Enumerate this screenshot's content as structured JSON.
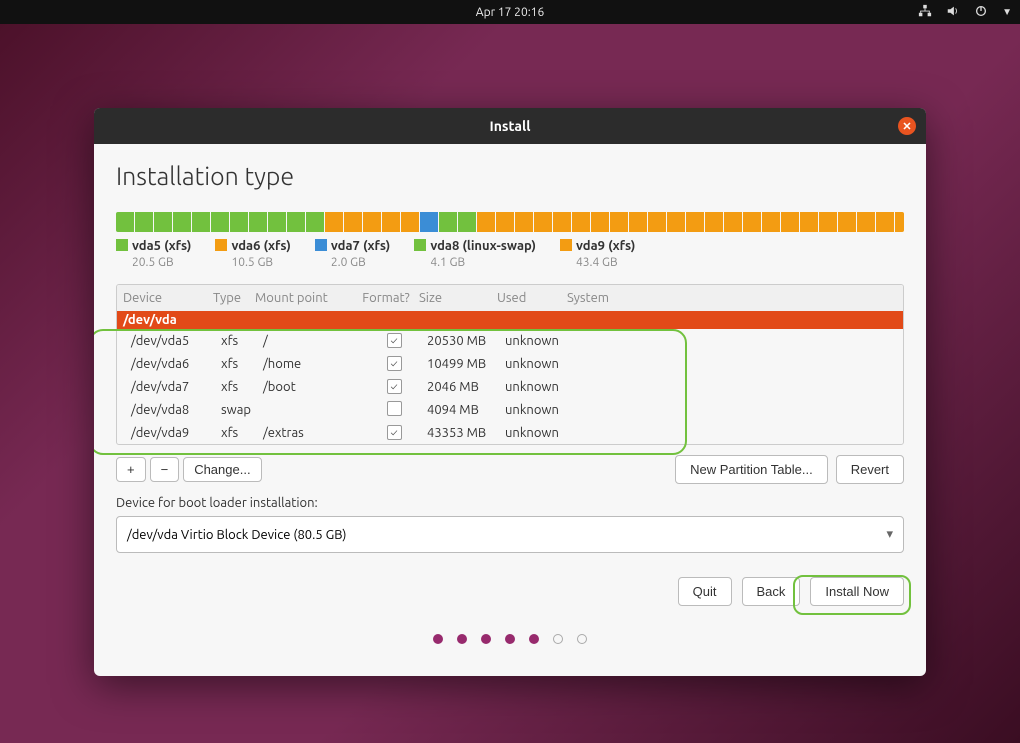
{
  "topbar": {
    "datetime": "Apr 17  20:16"
  },
  "window": {
    "title": "Install",
    "heading": "Installation type"
  },
  "legend": [
    {
      "name": "vda5 (xfs)",
      "sub": "20.5 GB",
      "color": "#72c13e"
    },
    {
      "name": "vda6 (xfs)",
      "sub": "10.5 GB",
      "color": "#f39c12"
    },
    {
      "name": "vda7 (xfs)",
      "sub": "2.0 GB",
      "color": "#3b8dd6"
    },
    {
      "name": "vda8 (linux-swap)",
      "sub": "4.1 GB",
      "color": "#72c13e"
    },
    {
      "name": "vda9 (xfs)",
      "sub": "43.4 GB",
      "color": "#f39c12"
    }
  ],
  "columns": {
    "device": "Device",
    "type": "Type",
    "mount": "Mount point",
    "format": "Format?",
    "size": "Size",
    "used": "Used",
    "system": "System"
  },
  "disk_header": "/dev/vda",
  "partitions": [
    {
      "device": "/dev/vda5",
      "type": "xfs",
      "mount": "/",
      "format": true,
      "size": "20530 MB",
      "used": "unknown"
    },
    {
      "device": "/dev/vda6",
      "type": "xfs",
      "mount": "/home",
      "format": true,
      "size": "10499 MB",
      "used": "unknown"
    },
    {
      "device": "/dev/vda7",
      "type": "xfs",
      "mount": "/boot",
      "format": true,
      "size": "2046 MB",
      "used": "unknown"
    },
    {
      "device": "/dev/vda8",
      "type": "swap",
      "mount": "",
      "format": false,
      "size": "4094 MB",
      "used": "unknown"
    },
    {
      "device": "/dev/vda9",
      "type": "xfs",
      "mount": "/extras",
      "format": true,
      "size": "43353 MB",
      "used": "unknown"
    }
  ],
  "toolbar": {
    "plus": "+",
    "minus": "−",
    "change": "Change...",
    "new_partition_table": "New Partition Table...",
    "revert": "Revert"
  },
  "bootloader": {
    "label": "Device for boot loader installation:",
    "value": "/dev/vda Virtio Block Device (80.5 GB)"
  },
  "footer": {
    "quit": "Quit",
    "back": "Back",
    "install": "Install Now"
  }
}
